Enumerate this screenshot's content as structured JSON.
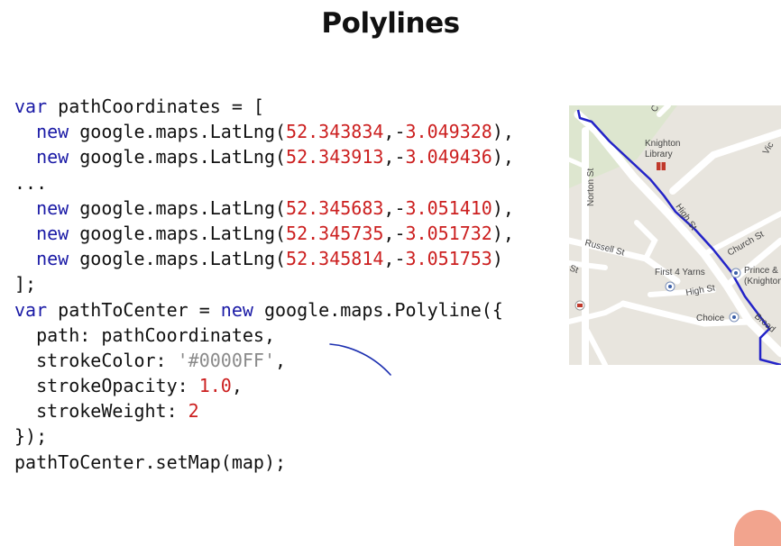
{
  "slide": {
    "title": "Polylines"
  },
  "code": {
    "lines": [
      [
        [
          "kw",
          "var"
        ],
        [
          "t",
          " pathCoordinates = ["
        ]
      ],
      [
        [
          "t",
          "  "
        ],
        [
          "kw",
          "new"
        ],
        [
          "t",
          " google.maps.LatLng("
        ],
        [
          "num",
          "52.343834"
        ],
        [
          "t",
          ",-"
        ],
        [
          "num",
          "3.049328"
        ],
        [
          "t",
          "),"
        ]
      ],
      [
        [
          "t",
          "  "
        ],
        [
          "kw",
          "new"
        ],
        [
          "t",
          " google.maps.LatLng("
        ],
        [
          "num",
          "52.343913"
        ],
        [
          "t",
          ",-"
        ],
        [
          "num",
          "3.049436"
        ],
        [
          "t",
          "),"
        ]
      ],
      [
        [
          "t",
          "..."
        ]
      ],
      [
        [
          "t",
          "  "
        ],
        [
          "kw",
          "new"
        ],
        [
          "t",
          " google.maps.LatLng("
        ],
        [
          "num",
          "52.345683"
        ],
        [
          "t",
          ",-"
        ],
        [
          "num",
          "3.051410"
        ],
        [
          "t",
          "),"
        ]
      ],
      [
        [
          "t",
          "  "
        ],
        [
          "kw",
          "new"
        ],
        [
          "t",
          " google.maps.LatLng("
        ],
        [
          "num",
          "52.345735"
        ],
        [
          "t",
          ",-"
        ],
        [
          "num",
          "3.051732"
        ],
        [
          "t",
          "),"
        ]
      ],
      [
        [
          "t",
          "  "
        ],
        [
          "kw",
          "new"
        ],
        [
          "t",
          " google.maps.LatLng("
        ],
        [
          "num",
          "52.345814"
        ],
        [
          "t",
          ",-"
        ],
        [
          "num",
          "3.051753"
        ],
        [
          "t",
          ")"
        ]
      ],
      [
        [
          "t",
          "];"
        ]
      ],
      [
        [
          "kw",
          "var"
        ],
        [
          "t",
          " pathToCenter = "
        ],
        [
          "kw",
          "new"
        ],
        [
          "t",
          " google.maps.Polyline({"
        ]
      ],
      [
        [
          "t",
          "  path: pathCoordinates,"
        ]
      ],
      [
        [
          "t",
          "  strokeColor: "
        ],
        [
          "str",
          "'#0000FF'"
        ],
        [
          "t",
          ","
        ]
      ],
      [
        [
          "t",
          "  strokeOpacity: "
        ],
        [
          "num",
          "1.0"
        ],
        [
          "t",
          ","
        ]
      ],
      [
        [
          "t",
          "  strokeWeight: "
        ],
        [
          "num",
          "2"
        ]
      ],
      [
        [
          "t",
          "});"
        ]
      ],
      [
        [
          "t",
          "pathToCenter.setMap(map);"
        ]
      ]
    ]
  },
  "map": {
    "labels": {
      "library": "Knighton",
      "library2": "Library",
      "norton": "Norton St",
      "russell": "Russell St",
      "high_st_vertical": "High St",
      "church": "Church St",
      "yarns": "First 4 Yarns",
      "high_st": "High St",
      "prince": "Prince & P",
      "prince2": "(Knighton",
      "choice": "Choice",
      "broad": "Broad",
      "vic": "Vic",
      "st_left": "St",
      "c_top": "C"
    },
    "colors": {
      "route": "#2323c8",
      "road": "#ffffff",
      "land": "#e8e5de",
      "park": "#dde6cf"
    },
    "route_color_hex": "#0000FF"
  },
  "icons": {
    "pin": "map-pin-icon",
    "book": "library-icon",
    "cart": "shop-icon",
    "play": "play-button-icon"
  }
}
